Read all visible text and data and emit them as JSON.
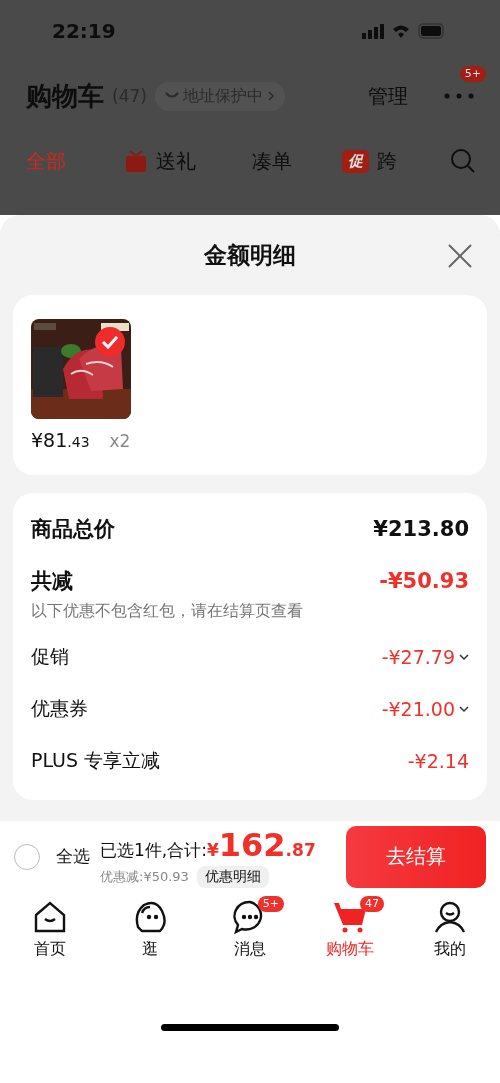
{
  "status_bar": {
    "time": "22:19"
  },
  "header": {
    "title": "购物车",
    "count": "(47)",
    "address_badge": "地址保护中",
    "manage": "管理",
    "more_badge": "5+"
  },
  "filter_tabs": [
    {
      "label": "全部",
      "selected": true,
      "kind": "plain"
    },
    {
      "label": "送礼",
      "selected": false,
      "kind": "gift"
    },
    {
      "label": "凑单",
      "selected": false,
      "kind": "plain"
    },
    {
      "label": "跨",
      "selected": false,
      "kind": "promo",
      "tag": "促"
    }
  ],
  "sheet": {
    "title": "金额明细",
    "items": [
      {
        "kind": "picture",
        "checked": true,
        "price_symbol": "¥",
        "price_integer": "81",
        "price_decimal": ".43",
        "quantity": "x2"
      }
    ],
    "total_label": "商品总价",
    "total_value": "¥213.80",
    "reduction_label": "共减",
    "reduction_value": "-¥50.93",
    "reduction_note": "以下优惠不包含红包，请在结算页查看",
    "discounts": [
      {
        "label": "促销",
        "value": "-¥27.79",
        "expandable": true
      },
      {
        "label": "优惠券",
        "value": "-¥21.00",
        "expandable": true
      },
      {
        "label": "PLUS 专享立减",
        "value": "-¥2.14",
        "expandable": false
      }
    ]
  },
  "checkout": {
    "select_all": {
      "label": "全选",
      "checked": false
    },
    "summary_label": "已选1件,合计:",
    "price_symbol": "¥",
    "price_integer": "162",
    "price_decimal": ".87",
    "discount_text": "优惠减:¥50.93",
    "details_button": "优惠明细",
    "submit": "去结算"
  },
  "bottom_nav": [
    {
      "label": "首页",
      "kind": "home",
      "selected": false
    },
    {
      "label": "逛",
      "kind": "face",
      "selected": false
    },
    {
      "label": "消息",
      "kind": "chat",
      "selected": false,
      "badge": "5+"
    },
    {
      "label": "购物车",
      "kind": "cart",
      "selected": true,
      "badge": "47"
    },
    {
      "label": "我的",
      "kind": "person",
      "selected": false
    }
  ]
}
